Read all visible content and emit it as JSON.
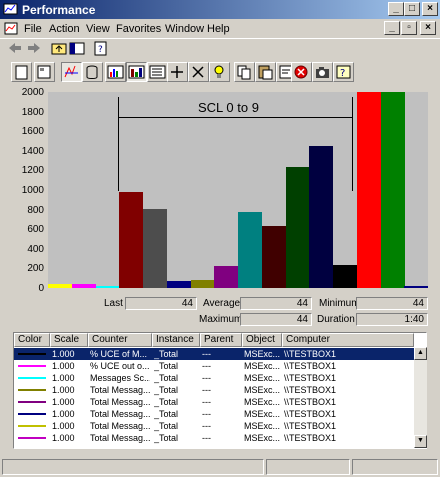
{
  "window": {
    "title": "Performance"
  },
  "menu": {
    "items": [
      "File",
      "Action",
      "View",
      "Favorites",
      "Window",
      "Help"
    ]
  },
  "graph": {
    "scale_annotation": "SCL 0 to 9",
    "yticks": [
      "2000",
      "1800",
      "1600",
      "1400",
      "1200",
      "1000",
      "800",
      "600",
      "400",
      "200",
      "0"
    ]
  },
  "stats": {
    "last_label": "Last",
    "last_value": "44",
    "average_label": "Average",
    "average_value": "44",
    "minimum_label": "Minimum",
    "minimum_value": "44",
    "maximum_label": "Maximum",
    "maximum_value": "44",
    "duration_label": "Duration",
    "duration_value": "1:40"
  },
  "legend": {
    "columns": [
      "Color",
      "Scale",
      "Counter",
      "Instance",
      "Parent",
      "Object",
      "Computer"
    ],
    "rows": [
      {
        "color": "#0a246a",
        "scale": "1.000",
        "counter": "% UCE of M...",
        "instance": "_Total",
        "parent": "---",
        "object": "MSExc...",
        "computer": "\\\\TESTBOX1"
      },
      {
        "color": "#ff00ff",
        "scale": "1.000",
        "counter": "% UCE out o...",
        "instance": "_Total",
        "parent": "---",
        "object": "MSExc...",
        "computer": "\\\\TESTBOX1"
      },
      {
        "color": "#00ffff",
        "scale": "1.000",
        "counter": "Messages Sc...",
        "instance": "_Total",
        "parent": "---",
        "object": "MSExc...",
        "computer": "\\\\TESTBOX1"
      },
      {
        "color": "#808000",
        "scale": "1.000",
        "counter": "Total Messag...",
        "instance": "_Total",
        "parent": "---",
        "object": "MSExc...",
        "computer": "\\\\TESTBOX1"
      },
      {
        "color": "#800080",
        "scale": "1.000",
        "counter": "Total Messag...",
        "instance": "_Total",
        "parent": "---",
        "object": "MSExc...",
        "computer": "\\\\TESTBOX1"
      },
      {
        "color": "#000080",
        "scale": "1.000",
        "counter": "Total Messag...",
        "instance": "_Total",
        "parent": "---",
        "object": "MSExc...",
        "computer": "\\\\TESTBOX1"
      },
      {
        "color": "#c0c000",
        "scale": "1.000",
        "counter": "Total Messag...",
        "instance": "_Total",
        "parent": "---",
        "object": "MSExc...",
        "computer": "\\\\TESTBOX1"
      },
      {
        "color": "#c000c0",
        "scale": "1.000",
        "counter": "Total Messag...",
        "instance": "_Total",
        "parent": "---",
        "object": "MSExc...",
        "computer": "\\\\TESTBOX1"
      }
    ]
  },
  "chart_data": {
    "type": "bar",
    "title": "",
    "ylim": [
      0,
      2000
    ],
    "values": [
      40,
      40,
      10,
      980,
      810,
      70,
      80,
      220,
      780,
      630,
      1230,
      1450,
      230,
      2000,
      2000,
      20
    ],
    "colors": [
      "#ffff00",
      "#ff00ff",
      "#00ffff",
      "#800000",
      "#4d4d4d",
      "#000080",
      "#808000",
      "#800080",
      "#008080",
      "#400000",
      "#004000",
      "#000040",
      "#000000",
      "#ff0000",
      "#008000",
      "#000080"
    ]
  }
}
